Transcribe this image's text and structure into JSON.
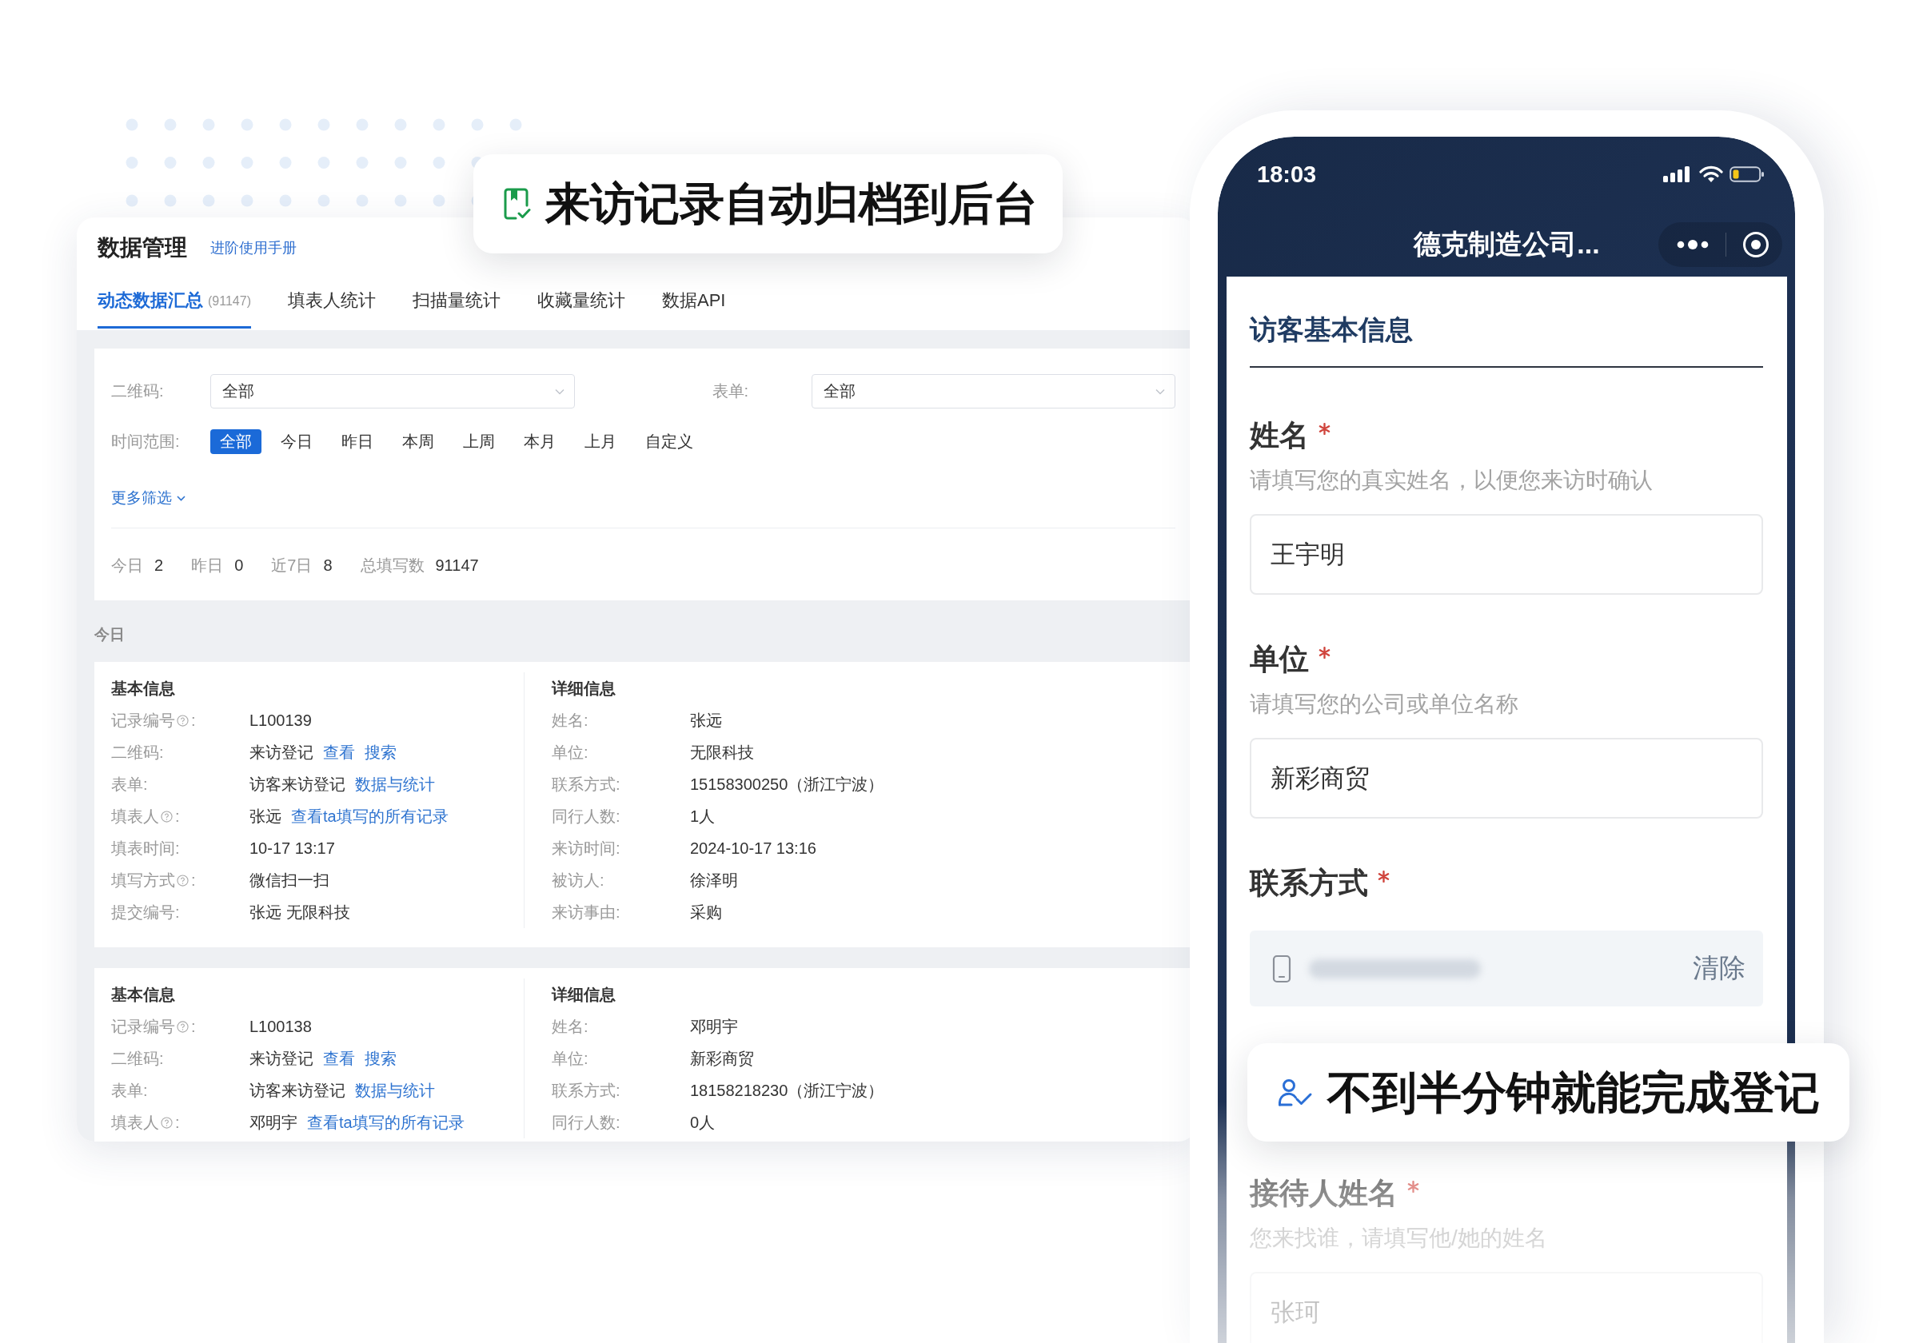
{
  "top_callout": {
    "text": "来访记录自动归档到后台"
  },
  "admin": {
    "title": "数据管理",
    "help_link": "进阶使用手册",
    "tabs": [
      {
        "label": "动态数据汇总",
        "count": "(91147)",
        "selected": true
      },
      {
        "label": "填表人统计",
        "selected": false
      },
      {
        "label": "扫描量统计",
        "selected": false
      },
      {
        "label": "收藏量统计",
        "selected": false
      },
      {
        "label": "数据API",
        "selected": false
      }
    ],
    "filters": {
      "qr_code": {
        "label": "二维码:",
        "value": "全部"
      },
      "form": {
        "label": "表单:",
        "value": "全部"
      },
      "time_range": {
        "label": "时间范围:",
        "options": [
          {
            "label": "全部",
            "selected": true
          },
          {
            "label": "今日",
            "selected": false
          },
          {
            "label": "昨日",
            "selected": false
          },
          {
            "label": "本周",
            "selected": false
          },
          {
            "label": "上周",
            "selected": false
          },
          {
            "label": "本月",
            "selected": false
          },
          {
            "label": "上月",
            "selected": false
          },
          {
            "label": "自定义",
            "selected": false
          }
        ]
      },
      "more_filters": "更多筛选"
    },
    "stats": [
      {
        "label": "今日",
        "value": "2"
      },
      {
        "label": "昨日",
        "value": "0"
      },
      {
        "label": "近7日",
        "value": "8"
      },
      {
        "label": "总填写数",
        "value": "91147"
      }
    ],
    "group_label": "今日",
    "records": [
      {
        "basic_title": "基本信息",
        "basic": [
          {
            "label": "记录编号",
            "help": true,
            "label_end": ":",
            "value": "L100139"
          },
          {
            "label": "二维码:",
            "help": false,
            "value": "来访登记",
            "links": [
              "查看",
              "搜索"
            ]
          },
          {
            "label": "表单:",
            "help": false,
            "value": "访客来访登记",
            "links": [
              "数据与统计"
            ]
          },
          {
            "label": "填表人",
            "help": true,
            "label_end": ":",
            "value": "张远",
            "links": [
              "查看ta填写的所有记录"
            ]
          },
          {
            "label": "填表时间:",
            "help": false,
            "value": "10-17 13:17"
          },
          {
            "label": "填写方式",
            "help": true,
            "label_end": ":",
            "value": "微信扫一扫"
          },
          {
            "label": "提交编号:",
            "help": false,
            "value": "张远 无限科技"
          }
        ],
        "detail_title": "详细信息",
        "detail": [
          {
            "label": "姓名:",
            "value": "张远"
          },
          {
            "label": "单位:",
            "value": "无限科技"
          },
          {
            "label": "联系方式:",
            "value": "15158300250（浙江宁波）"
          },
          {
            "label": "同行人数:",
            "value": "1人"
          },
          {
            "label": "来访时间:",
            "value": "2024-10-17 13:16"
          },
          {
            "label": "被访人:",
            "value": "徐泽明"
          },
          {
            "label": "来访事由:",
            "value": "采购"
          }
        ]
      },
      {
        "basic_title": "基本信息",
        "basic": [
          {
            "label": "记录编号",
            "help": true,
            "label_end": ":",
            "value": "L100138"
          },
          {
            "label": "二维码:",
            "help": false,
            "value": "来访登记",
            "links": [
              "查看",
              "搜索"
            ]
          },
          {
            "label": "表单:",
            "help": false,
            "value": "访客来访登记",
            "links": [
              "数据与统计"
            ]
          },
          {
            "label": "填表人",
            "help": true,
            "label_end": ":",
            "value": "邓明宇",
            "links": [
              "查看ta填写的所有记录"
            ]
          }
        ],
        "detail_title": "详细信息",
        "detail": [
          {
            "label": "姓名:",
            "value": "邓明宇"
          },
          {
            "label": "单位:",
            "value": "新彩商贸"
          },
          {
            "label": "联系方式:",
            "value": "18158218230（浙江宁波）"
          },
          {
            "label": "同行人数:",
            "value": "0人"
          }
        ]
      }
    ]
  },
  "phone": {
    "time": "18:03",
    "title": "德克制造公司...",
    "section_title": "访客基本信息",
    "fields": [
      {
        "kind": "text",
        "label": "姓名",
        "required": true,
        "hint": "请填写您的真实姓名，以便您来访时确认",
        "value": "王宇明"
      },
      {
        "kind": "text",
        "label": "单位",
        "required": true,
        "hint": "请填写您的公司或单位名称",
        "value": "新彩商贸"
      },
      {
        "kind": "phone",
        "label": "联系方式",
        "required": true,
        "clear_button": "清除"
      },
      {
        "kind": "text",
        "label": "接待人姓名",
        "required": true,
        "hint": "您来找谁，请填写他/她的姓名",
        "value": "张珂"
      }
    ]
  },
  "bottom_callout": {
    "text": "不到半分钟就能完成登记"
  }
}
